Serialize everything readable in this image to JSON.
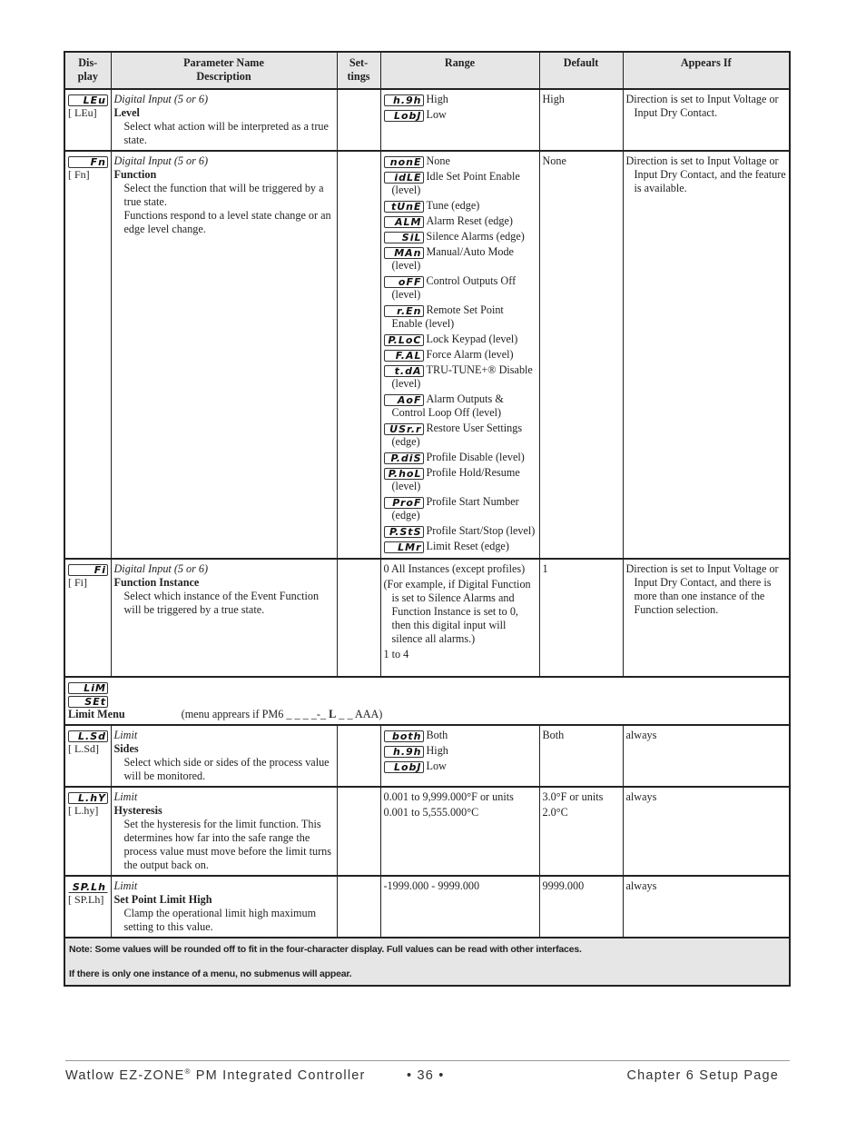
{
  "table": {
    "headers": {
      "display": "Dis-\nplay",
      "display_l1": "Dis-",
      "display_l2": "play",
      "name_l1": "Parameter Name",
      "name_l2": "Description",
      "settings_l1": "Set-",
      "settings_l2": "tings",
      "range": "Range",
      "default": "Default",
      "appears_if": "Appears If"
    },
    "rows": [
      {
        "lcd": "LEu",
        "bracket": "[  LEu]",
        "category": "Digital Input (5 or 6)",
        "name": "Level",
        "description": [
          "Select what action will be interpreted as a true state."
        ],
        "settings": "",
        "range": [
          {
            "lcd": "h.9h",
            "label": "High"
          },
          {
            "lcd": "LobJ",
            "label": "Low"
          }
        ],
        "default": "High",
        "appears_if": "Direction is set to Input Voltage or Input Dry Contact."
      },
      {
        "lcd": "Fn",
        "bracket": "[   Fn]",
        "category": "Digital Input (5 or 6)",
        "name": "Function",
        "description": [
          "Select the function that will be triggered by a true state.",
          "Functions respond to a level state change or an edge level change."
        ],
        "settings": "",
        "range": [
          {
            "lcd": "nonE",
            "label": "None"
          },
          {
            "lcd": "idLE",
            "label": "Idle Set Point Enable (level)"
          },
          {
            "lcd": "tUnE",
            "label": "Tune (edge)"
          },
          {
            "lcd": "ALM",
            "label": "Alarm Reset (edge)"
          },
          {
            "lcd": "SiL",
            "label": "Silence Alarms (edge)"
          },
          {
            "lcd": "MAn",
            "label": "Manual/Auto Mode (level)"
          },
          {
            "lcd": "oFF",
            "label": "Control Outputs Off (level)"
          },
          {
            "lcd": "r.En",
            "label": "Remote Set Point Enable (level)"
          },
          {
            "lcd": "P.LoC",
            "label": "Lock Keypad (level)"
          },
          {
            "lcd": "F.AL",
            "label": "Force Alarm (level)"
          },
          {
            "lcd": "t.dA",
            "label": "TRU-TUNE+® Disable (level)"
          },
          {
            "lcd": "AoF",
            "label": "Alarm Outputs & Control Loop Off (level)"
          },
          {
            "lcd": "USr.r",
            "label": "Restore User Settings (edge)"
          },
          {
            "lcd": "P.diS",
            "label": "Profile Disable (level)"
          },
          {
            "lcd": "P.hoL",
            "label": "Profile Hold/Resume (level)"
          },
          {
            "lcd": "ProF",
            "label": "Profile Start Number (edge)"
          },
          {
            "lcd": "P.StS",
            "label": "Profile Start/Stop (level)"
          },
          {
            "lcd": "LMr",
            "label": "Limit Reset (edge)"
          }
        ],
        "default": "None",
        "appears_if": "Direction is set to Input Voltage or Input Dry Contact, and the feature is available."
      },
      {
        "lcd": "Fi",
        "bracket": "[   Fi]",
        "category": "Digital Input (5 or 6)",
        "name": "Function Instance",
        "description": [
          "Select which instance of the Event Function will be triggered by a true state."
        ],
        "settings": "",
        "range_text": [
          "0 All Instances (except profiles)",
          "(For example, if Digital Function is set to Silence Alarms and Function Instance is set to 0, then this digital input will silence all alarms.)",
          "1 to 4"
        ],
        "default": "1",
        "appears_if": "Direction is set to Input Voltage or Input Dry Contact, and there is more than one instance of the Function selection."
      }
    ],
    "limit_menu": {
      "lcd1": "LiM",
      "lcd2": "SEt",
      "title": "Limit Menu",
      "note_prefix": "(menu apprears if PM6 _ _ _ _-_ ",
      "note_bold": "L",
      "note_suffix": " _ _ AAA)"
    },
    "limit_rows": [
      {
        "lcd": "L.Sd",
        "bracket": "[ L.Sd]",
        "category": "Limit",
        "name": "Sides",
        "description": [
          "Select which side or sides of the process value will be monitored."
        ],
        "settings": "",
        "range": [
          {
            "lcd": "both",
            "label": "Both"
          },
          {
            "lcd": "h.9h",
            "label": "High"
          },
          {
            "lcd": "LobJ",
            "label": "Low"
          }
        ],
        "default": "Both",
        "appears_if": "always"
      },
      {
        "lcd": "L.hY",
        "bracket": "[ L.hy]",
        "category": "Limit",
        "name": "Hysteresis",
        "description": [
          "Set the hysteresis for the limit function. This determines how far into the safe range the process value must move before the limit turns the output back on."
        ],
        "settings": "",
        "range_text": [
          "0.001 to 9,999.000°F or units",
          "0.001 to 5,555.000°C"
        ],
        "default_lines": [
          "3.0°F or units",
          "2.0°C"
        ],
        "appears_if": "always"
      },
      {
        "lcd": "SP.Lh",
        "bracket": "[ SP.Lh]",
        "category": "Limit",
        "name": "Set Point Limit High",
        "description": [
          "Clamp the operational limit high maximum setting to this value."
        ],
        "settings": "",
        "range_text": [
          "-1999.000 - 9999.000"
        ],
        "default": "9999.000",
        "appears_if": "always"
      }
    ],
    "notes": [
      "Note: Some values will be rounded off to fit in the four-character display. Full values can be read with other interfaces.",
      "If there is only one instance of a menu, no submenus will appear."
    ]
  },
  "footer": {
    "left_prefix": "Watlow EZ-ZONE",
    "left_sup": "®",
    "left_suffix": " PM Integrated Controller",
    "page": "•  36  •",
    "right": "Chapter 6 Setup Page"
  }
}
